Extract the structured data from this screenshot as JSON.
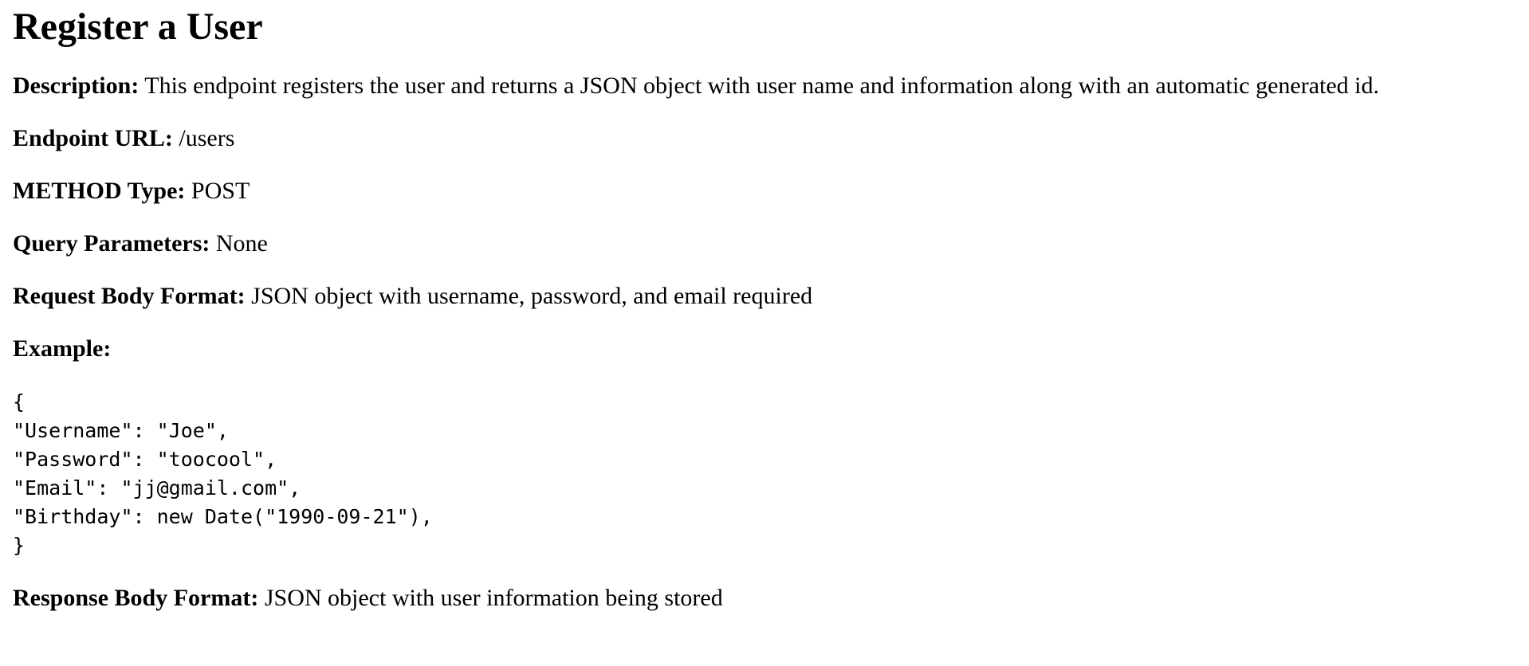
{
  "page": {
    "title": "Register a User",
    "fields": {
      "description": {
        "label": "Description:",
        "value": " This endpoint registers the user and returns a JSON object with user name and information along with an automatic generated id."
      },
      "endpoint_url": {
        "label": "Endpoint URL:",
        "value": " /users"
      },
      "method_type": {
        "label": "METHOD Type:",
        "value": " POST"
      },
      "query_parameters": {
        "label": "Query Parameters:",
        "value": " None"
      },
      "request_body_format": {
        "label": "Request Body Format:",
        "value": " JSON object with username, password, and email required"
      },
      "example": {
        "label": "Example:"
      },
      "response_body_format": {
        "label": "Response Body Format:",
        "value": " JSON object with user information being stored"
      }
    },
    "example_code": [
      "{",
      "\"Username\": \"Joe\",",
      "\"Password\": \"toocool\",",
      "\"Email\": \"jj@gmail.com\",",
      "\"Birthday\": new Date(\"1990-09-21\"),",
      "}"
    ]
  }
}
